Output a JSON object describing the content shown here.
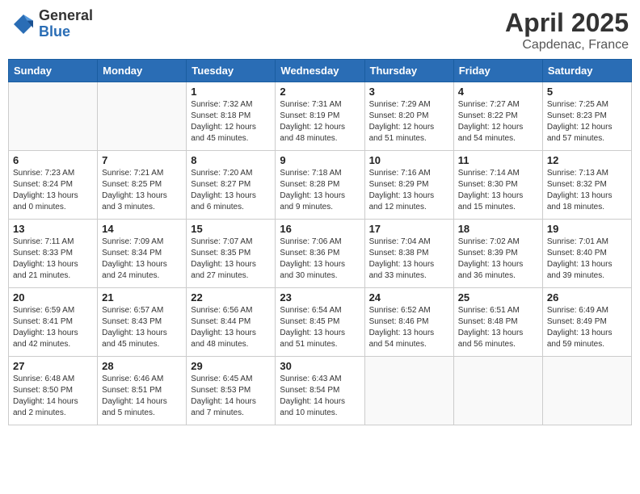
{
  "header": {
    "logo_general": "General",
    "logo_blue": "Blue",
    "month_year": "April 2025",
    "location": "Capdenac, France"
  },
  "days_of_week": [
    "Sunday",
    "Monday",
    "Tuesday",
    "Wednesday",
    "Thursday",
    "Friday",
    "Saturday"
  ],
  "weeks": [
    [
      {
        "day": "",
        "info": ""
      },
      {
        "day": "",
        "info": ""
      },
      {
        "day": "1",
        "sunrise": "7:32 AM",
        "sunset": "8:18 PM",
        "daylight": "12 hours and 45 minutes."
      },
      {
        "day": "2",
        "sunrise": "7:31 AM",
        "sunset": "8:19 PM",
        "daylight": "12 hours and 48 minutes."
      },
      {
        "day": "3",
        "sunrise": "7:29 AM",
        "sunset": "8:20 PM",
        "daylight": "12 hours and 51 minutes."
      },
      {
        "day": "4",
        "sunrise": "7:27 AM",
        "sunset": "8:22 PM",
        "daylight": "12 hours and 54 minutes."
      },
      {
        "day": "5",
        "sunrise": "7:25 AM",
        "sunset": "8:23 PM",
        "daylight": "12 hours and 57 minutes."
      }
    ],
    [
      {
        "day": "6",
        "sunrise": "7:23 AM",
        "sunset": "8:24 PM",
        "daylight": "13 hours and 0 minutes."
      },
      {
        "day": "7",
        "sunrise": "7:21 AM",
        "sunset": "8:25 PM",
        "daylight": "13 hours and 3 minutes."
      },
      {
        "day": "8",
        "sunrise": "7:20 AM",
        "sunset": "8:27 PM",
        "daylight": "13 hours and 6 minutes."
      },
      {
        "day": "9",
        "sunrise": "7:18 AM",
        "sunset": "8:28 PM",
        "daylight": "13 hours and 9 minutes."
      },
      {
        "day": "10",
        "sunrise": "7:16 AM",
        "sunset": "8:29 PM",
        "daylight": "13 hours and 12 minutes."
      },
      {
        "day": "11",
        "sunrise": "7:14 AM",
        "sunset": "8:30 PM",
        "daylight": "13 hours and 15 minutes."
      },
      {
        "day": "12",
        "sunrise": "7:13 AM",
        "sunset": "8:32 PM",
        "daylight": "13 hours and 18 minutes."
      }
    ],
    [
      {
        "day": "13",
        "sunrise": "7:11 AM",
        "sunset": "8:33 PM",
        "daylight": "13 hours and 21 minutes."
      },
      {
        "day": "14",
        "sunrise": "7:09 AM",
        "sunset": "8:34 PM",
        "daylight": "13 hours and 24 minutes."
      },
      {
        "day": "15",
        "sunrise": "7:07 AM",
        "sunset": "8:35 PM",
        "daylight": "13 hours and 27 minutes."
      },
      {
        "day": "16",
        "sunrise": "7:06 AM",
        "sunset": "8:36 PM",
        "daylight": "13 hours and 30 minutes."
      },
      {
        "day": "17",
        "sunrise": "7:04 AM",
        "sunset": "8:38 PM",
        "daylight": "13 hours and 33 minutes."
      },
      {
        "day": "18",
        "sunrise": "7:02 AM",
        "sunset": "8:39 PM",
        "daylight": "13 hours and 36 minutes."
      },
      {
        "day": "19",
        "sunrise": "7:01 AM",
        "sunset": "8:40 PM",
        "daylight": "13 hours and 39 minutes."
      }
    ],
    [
      {
        "day": "20",
        "sunrise": "6:59 AM",
        "sunset": "8:41 PM",
        "daylight": "13 hours and 42 minutes."
      },
      {
        "day": "21",
        "sunrise": "6:57 AM",
        "sunset": "8:43 PM",
        "daylight": "13 hours and 45 minutes."
      },
      {
        "day": "22",
        "sunrise": "6:56 AM",
        "sunset": "8:44 PM",
        "daylight": "13 hours and 48 minutes."
      },
      {
        "day": "23",
        "sunrise": "6:54 AM",
        "sunset": "8:45 PM",
        "daylight": "13 hours and 51 minutes."
      },
      {
        "day": "24",
        "sunrise": "6:52 AM",
        "sunset": "8:46 PM",
        "daylight": "13 hours and 54 minutes."
      },
      {
        "day": "25",
        "sunrise": "6:51 AM",
        "sunset": "8:48 PM",
        "daylight": "13 hours and 56 minutes."
      },
      {
        "day": "26",
        "sunrise": "6:49 AM",
        "sunset": "8:49 PM",
        "daylight": "13 hours and 59 minutes."
      }
    ],
    [
      {
        "day": "27",
        "sunrise": "6:48 AM",
        "sunset": "8:50 PM",
        "daylight": "14 hours and 2 minutes."
      },
      {
        "day": "28",
        "sunrise": "6:46 AM",
        "sunset": "8:51 PM",
        "daylight": "14 hours and 5 minutes."
      },
      {
        "day": "29",
        "sunrise": "6:45 AM",
        "sunset": "8:53 PM",
        "daylight": "14 hours and 7 minutes."
      },
      {
        "day": "30",
        "sunrise": "6:43 AM",
        "sunset": "8:54 PM",
        "daylight": "14 hours and 10 minutes."
      },
      {
        "day": "",
        "info": ""
      },
      {
        "day": "",
        "info": ""
      },
      {
        "day": "",
        "info": ""
      }
    ]
  ]
}
